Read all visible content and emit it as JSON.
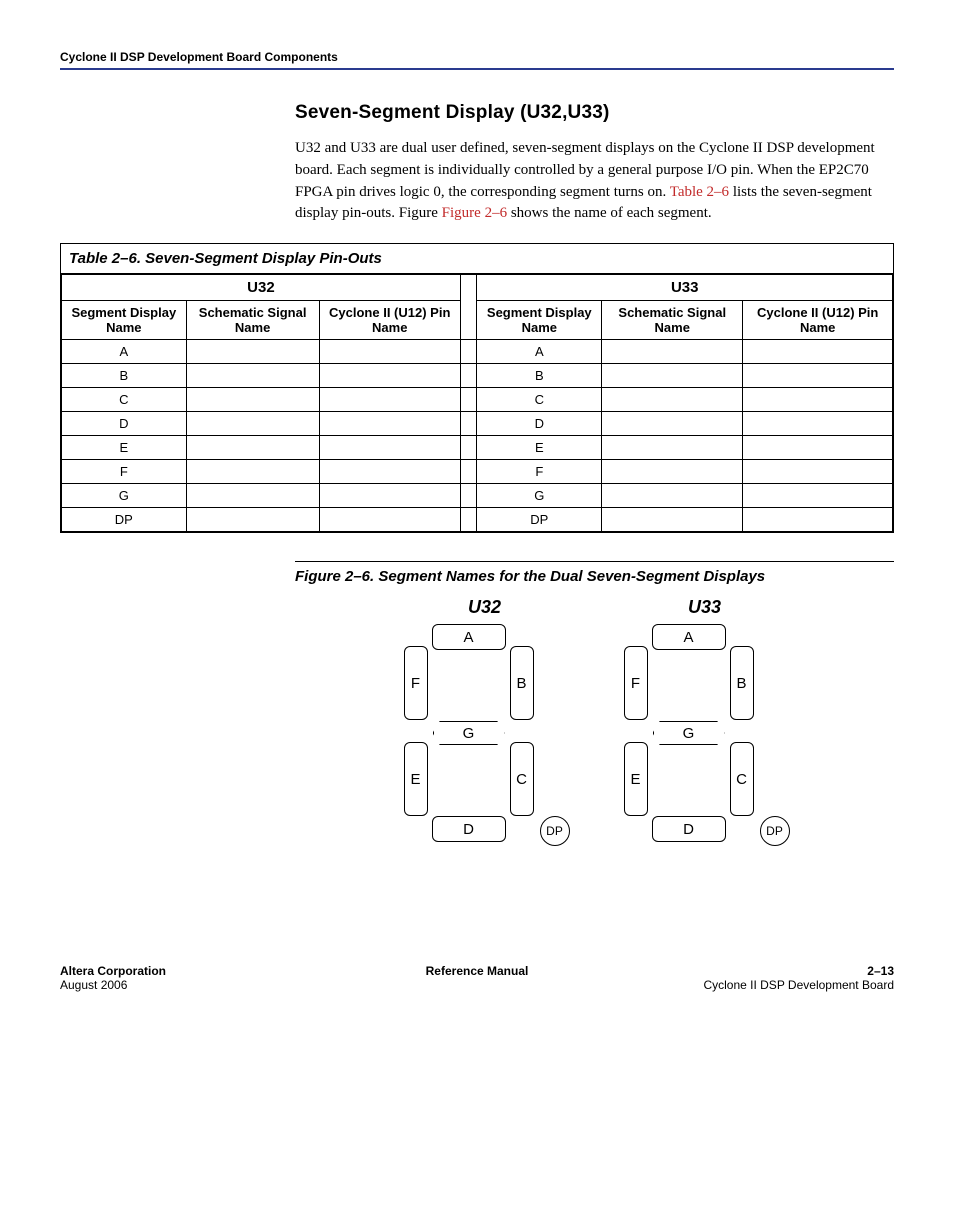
{
  "running_head": "Cyclone II DSP Development Board Components",
  "section_heading": "Seven-Segment Display (U32,U33)",
  "body_paragraph_parts": [
    "U32 and U33 are dual user defined, seven-segment displays on the Cyclone II DSP development board. Each segment is individually controlled by a general purpose I/O pin. When the EP2C70 FPGA pin drives logic 0, the corresponding segment turns on. ",
    "Table 2–6",
    " lists the seven-segment display pin-outs. Figure ",
    "Figure 2–6",
    " shows the name of each segment."
  ],
  "table": {
    "caption": "Table 2–6. Seven-Segment Display Pin-Outs",
    "group_left": "U32",
    "group_right": "U33",
    "col_headers": {
      "seg": "Segment Display Name",
      "sig": "Schematic Signal Name",
      "pin": "Cyclone II (U12) Pin Name"
    },
    "rows": [
      {
        "l_seg": "A",
        "l_sig": "",
        "l_pin": "",
        "r_seg": "A",
        "r_sig": "",
        "r_pin": ""
      },
      {
        "l_seg": "B",
        "l_sig": "",
        "l_pin": "",
        "r_seg": "B",
        "r_sig": "",
        "r_pin": ""
      },
      {
        "l_seg": "C",
        "l_sig": "",
        "l_pin": "",
        "r_seg": "C",
        "r_sig": "",
        "r_pin": ""
      },
      {
        "l_seg": "D",
        "l_sig": "",
        "l_pin": "",
        "r_seg": "D",
        "r_sig": "",
        "r_pin": ""
      },
      {
        "l_seg": "E",
        "l_sig": "",
        "l_pin": "",
        "r_seg": "E",
        "r_sig": "",
        "r_pin": ""
      },
      {
        "l_seg": "F",
        "l_sig": "",
        "l_pin": "",
        "r_seg": "F",
        "r_sig": "",
        "r_pin": ""
      },
      {
        "l_seg": "G",
        "l_sig": "",
        "l_pin": "",
        "r_seg": "G",
        "r_sig": "",
        "r_pin": ""
      },
      {
        "l_seg": "DP",
        "l_sig": "",
        "l_pin": "",
        "r_seg": "DP",
        "r_sig": "",
        "r_pin": ""
      }
    ]
  },
  "figure": {
    "caption": "Figure 2–6. Segment Names for the Dual Seven-Segment Displays",
    "left_title": "U32",
    "right_title": "U33",
    "segments": {
      "A": "A",
      "B": "B",
      "C": "C",
      "D": "D",
      "E": "E",
      "F": "F",
      "G": "G",
      "DP": "DP"
    }
  },
  "footer": {
    "left_top": "Altera Corporation",
    "left_bottom": "August 2006",
    "center": "Reference Manual",
    "right_top": "2–13",
    "right_bottom": "Cyclone II DSP Development Board"
  }
}
